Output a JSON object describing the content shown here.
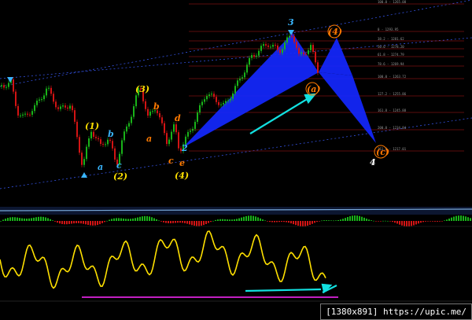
{
  "colors": {
    "background": "#000000",
    "price_up": "#19b319",
    "price_down": "#d21414",
    "pattern_fill": "#1428ff",
    "oscillator": "#ffe000",
    "oscillator_base": "#c21fc2",
    "arrow": "#12e0e0",
    "fib_line": "#b51818",
    "wave_main": "#ffe000",
    "wave_sub": "#ff7a00",
    "wave_cyan": "#3ab6ff",
    "point_x": "#ff9a00",
    "dim_label": "#9a9a9a",
    "trendline": "#3a5cff"
  },
  "wave_labels": {
    "w1": "(1)",
    "w2": "(2)",
    "w3": "(3)",
    "w4": "(4)",
    "wa1": "a",
    "wb1": "b",
    "wc1": "c",
    "wa2": "a",
    "wb2": "b",
    "wc2": "c",
    "wd": "d",
    "we": "e",
    "w2b": "2",
    "w3b": "3",
    "w4b": "4",
    "w4c": "(4)",
    "wpos": "(a)",
    "wc": "(c)"
  },
  "fib_levels": [
    "0 - 1293.95",
    "100.0 - 1265.08",
    "38.2 - 1281.62",
    "50.0 - 1278.20",
    "61.8 - 1274.79",
    "78.6 - 1269.94",
    "100.0 - 1263.72",
    "127.2 - 1255.86",
    "161.8 - 1245.88",
    "200.0 - 1234.84",
    "261.8 - 1217.01"
  ],
  "watermark": "[1380x891] https://upic.me/"
}
